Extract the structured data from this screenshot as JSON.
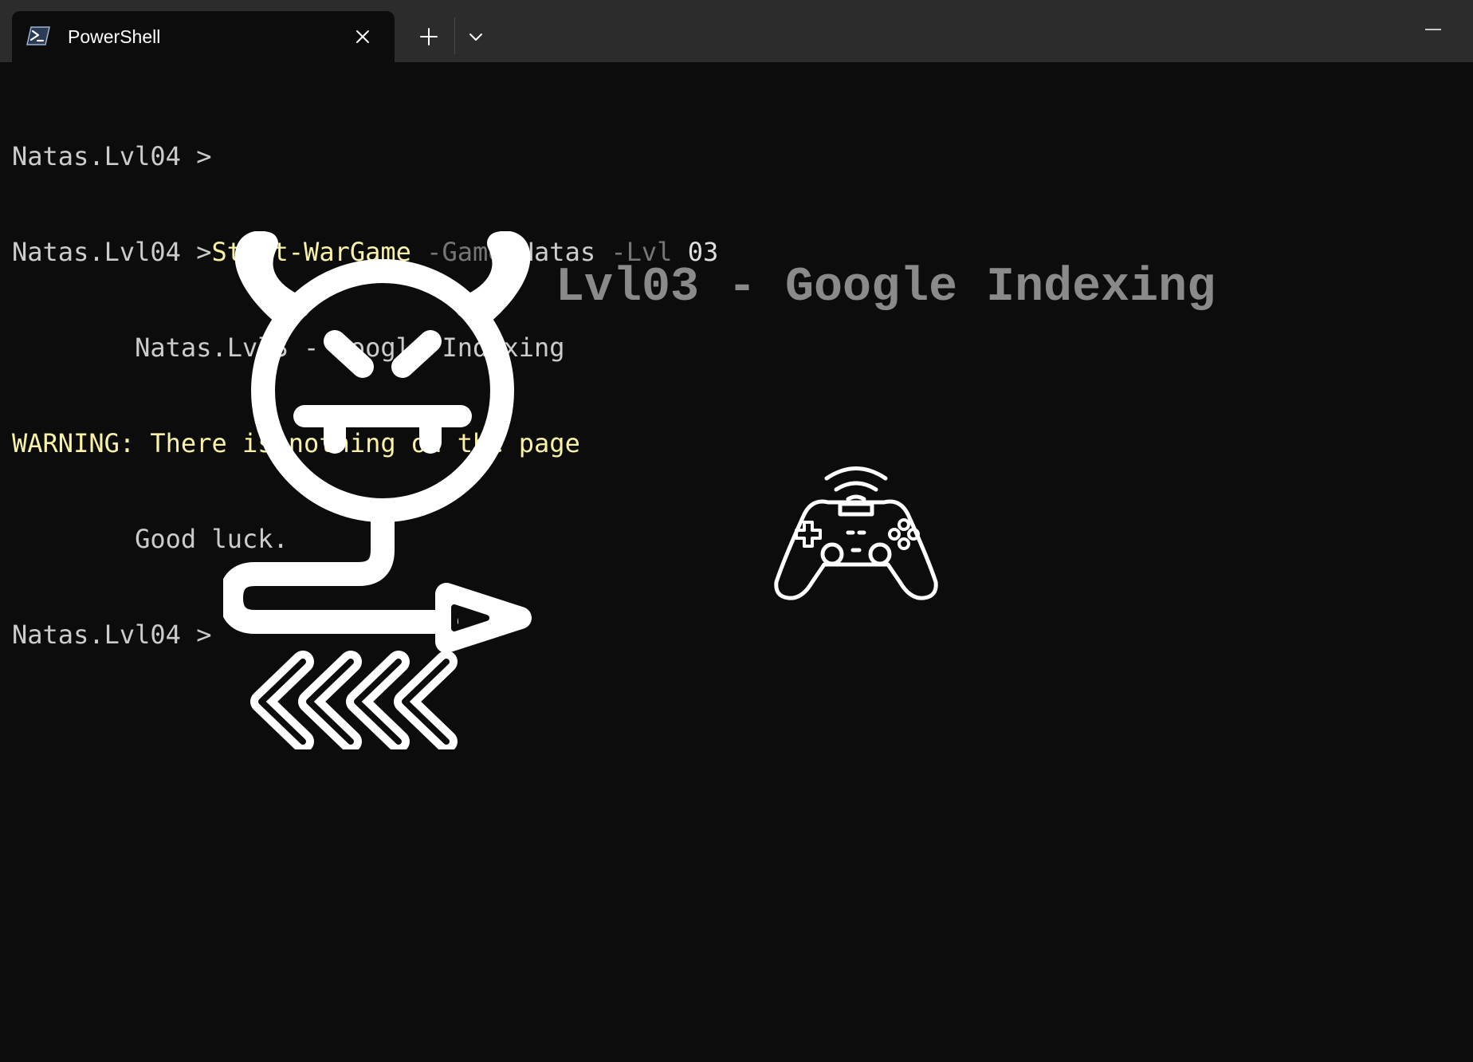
{
  "window": {
    "tab_title": "PowerShell",
    "tab_icon": "powershell-icon",
    "new_tab_icon": "plus-icon",
    "dropdown_icon": "chevron-down-icon",
    "close_icon": "close-icon",
    "minimize_icon": "minimize-icon"
  },
  "terminal": {
    "line1": {
      "prompt": "Natas.Lvl04 >"
    },
    "line2": {
      "prompt": "Natas.Lvl04 >",
      "command": "Start-WarGame",
      "param1": "-Game",
      "arg1": "Natas",
      "param2": "-Lvl",
      "arg2": "03"
    },
    "line3": "        Natas.Lvl3 - Google Indexing",
    "line4": "WARNING: There is nothing on the page",
    "line5": "        Good luck.",
    "line6": {
      "prompt": "Natas.Lvl04 >"
    }
  },
  "banner": {
    "title": "Lvl03 - Google Indexing"
  },
  "art": {
    "devil_icon": "devil-icon",
    "rewind_icon": "chevrons-left-icon",
    "gamepad_icon": "gamepad-icon"
  },
  "colors": {
    "background": "#0c0c0c",
    "titlebar": "#2c2c2c",
    "command": "#f9f1a5",
    "warning": "#f9f1a5",
    "parameter": "#767676",
    "text": "#cccccc",
    "banner": "#8a8a8a"
  }
}
